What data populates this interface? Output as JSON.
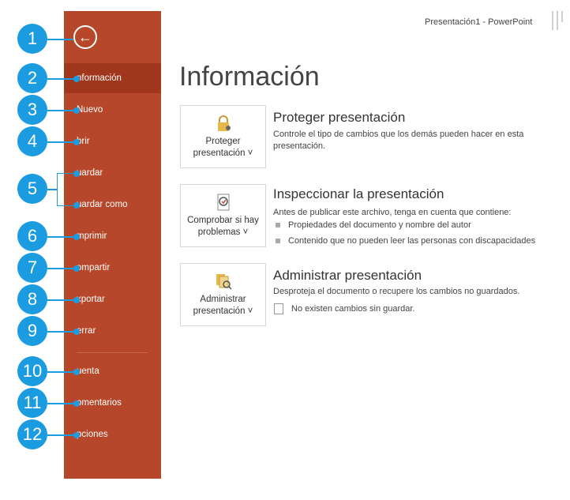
{
  "window": {
    "title": "Presentación1 - PowerPoint"
  },
  "sidebar": {
    "back_icon": "back-arrow-icon",
    "items": [
      {
        "label": "nformación",
        "active": true
      },
      {
        "label": "Nuevo"
      },
      {
        "label": "brir"
      },
      {
        "label": "uardar"
      },
      {
        "label": "uardar como"
      },
      {
        "label": "mprimir"
      },
      {
        "label": "ompartir"
      },
      {
        "label": "xportar"
      },
      {
        "label": "errar"
      },
      {
        "label": "uenta"
      },
      {
        "label": "omentarios"
      },
      {
        "label": "pciones"
      }
    ],
    "accent_color": "#b7472a"
  },
  "main": {
    "title": "Información",
    "sections": [
      {
        "button_label": "Proteger presentación ˅",
        "icon": "lock-key-icon",
        "title": "Proteger presentación",
        "description": "Controle el tipo de cambios que los demás pueden hacer en esta presentación."
      },
      {
        "button_label": "Comprobar si hay problemas ˅",
        "icon": "inspect-document-icon",
        "title": "Inspeccionar la presentación",
        "description": "Antes de publicar este archivo, tenga en cuenta que contiene:",
        "bullets": [
          "Propiedades del documento y nombre del autor",
          "Contenido que no pueden leer las personas con discapacidades"
        ]
      },
      {
        "button_label": "Administrar presentación ˅",
        "icon": "manage-versions-icon",
        "title": "Administrar presentación",
        "description": "Desproteja el documento o recupere los cambios no guardados.",
        "status": "No existen cambios sin guardar."
      }
    ]
  },
  "callouts": [
    "1",
    "2",
    "3",
    "4",
    "5",
    "6",
    "7",
    "8",
    "9",
    "10",
    "11",
    "12"
  ],
  "callout_color": "#1b9be0"
}
